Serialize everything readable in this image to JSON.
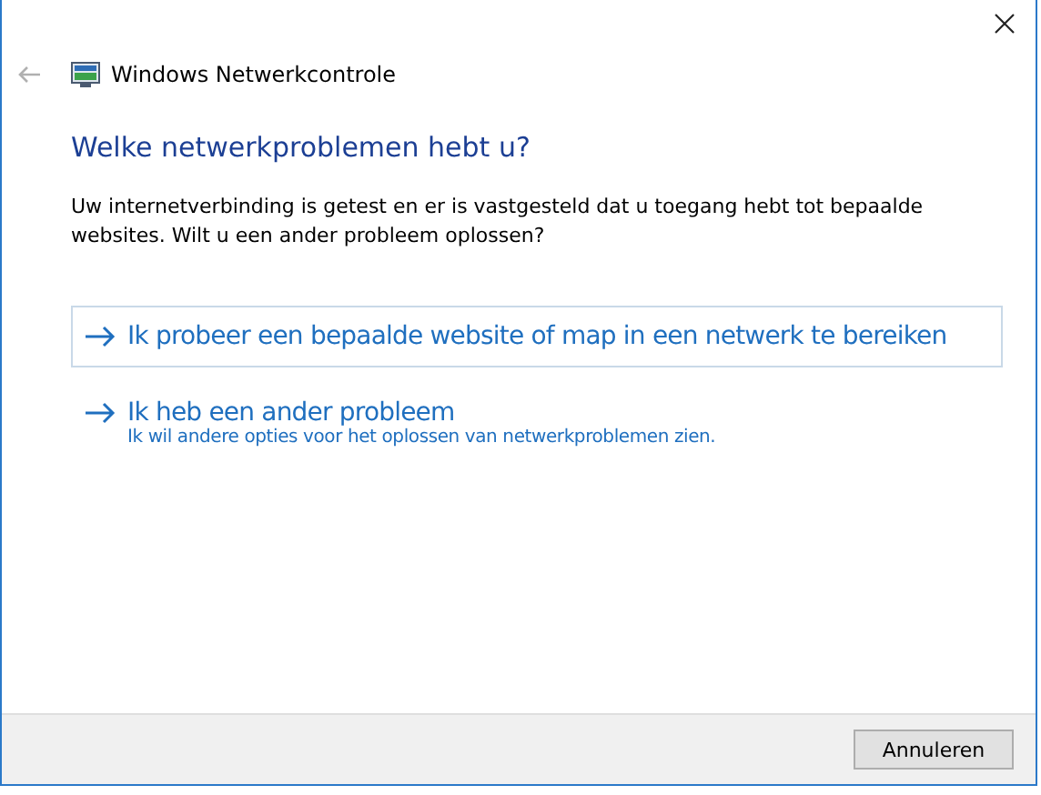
{
  "window": {
    "title": "Windows Netwerkcontrole",
    "back_enabled": false
  },
  "heading": "Welke netwerkproblemen hebt u?",
  "description": "Uw internetverbinding is getest en er is vastgesteld dat u toegang hebt tot bepaalde websites. Wilt u een ander probleem oplossen?",
  "options": [
    {
      "title": "Ik probeer een bepaalde website of map in een netwerk te bereiken",
      "highlighted": true
    },
    {
      "title": "Ik heb een ander probleem",
      "subtitle": "Ik wil andere opties voor het oplossen van netwerkproblemen zien.",
      "highlighted": false
    }
  ],
  "buttons": [
    "Annuleren"
  ]
}
